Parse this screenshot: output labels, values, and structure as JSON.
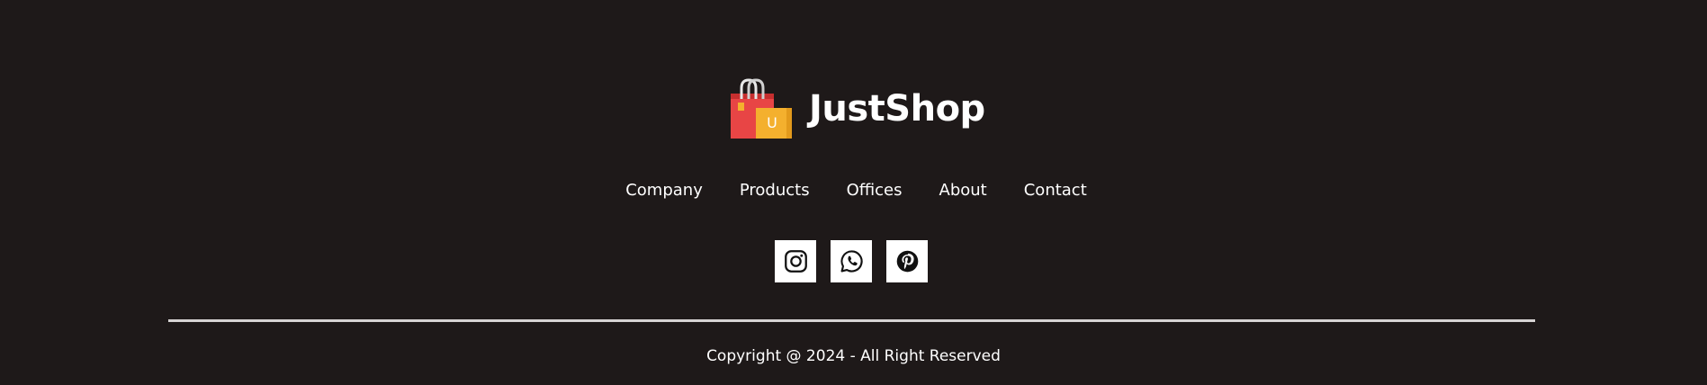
{
  "brand": {
    "name": "JustShop",
    "logo_icon": "shopping-bags-icon",
    "logo_letter": "U",
    "colors": {
      "bag_red": "#e84545",
      "bag_red_dark": "#c62f2f",
      "bag_yellow": "#f4b02e",
      "bag_yellow_dark": "#e39a1c"
    }
  },
  "nav": {
    "items": [
      {
        "label": "Company"
      },
      {
        "label": "Products"
      },
      {
        "label": "Offices"
      },
      {
        "label": "About"
      },
      {
        "label": "Contact"
      }
    ]
  },
  "social": {
    "items": [
      {
        "icon": "instagram-icon"
      },
      {
        "icon": "whatsapp-icon"
      },
      {
        "icon": "pinterest-icon"
      }
    ]
  },
  "footer": {
    "copyright": "Copyright @ 2024 - All Right Reserved"
  },
  "theme": {
    "background": "#1e1919",
    "text": "#ffffff",
    "divider": "#d6d3d3"
  }
}
